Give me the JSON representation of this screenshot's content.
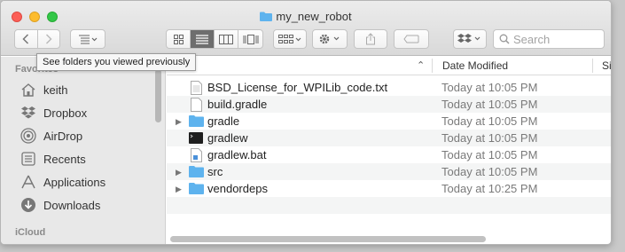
{
  "window": {
    "title": "my_new_robot"
  },
  "toolbar": {
    "search_placeholder": "Search"
  },
  "tooltip": "See folders you viewed previously",
  "sidebar": {
    "favorites_header": "Favorites",
    "items": [
      {
        "label": "keith",
        "icon": "home-icon"
      },
      {
        "label": "Dropbox",
        "icon": "dropbox-icon"
      },
      {
        "label": "AirDrop",
        "icon": "airdrop-icon"
      },
      {
        "label": "Recents",
        "icon": "recents-icon"
      },
      {
        "label": "Applications",
        "icon": "applications-icon"
      },
      {
        "label": "Downloads",
        "icon": "downloads-icon"
      }
    ],
    "icloud_header": "iCloud"
  },
  "columns": {
    "date_modified": "Date Modified",
    "size": "Si"
  },
  "files": [
    {
      "name": "BSD_License_for_WPILib_code.txt",
      "date": "Today at 10:05 PM",
      "kind": "text-file"
    },
    {
      "name": "build.gradle",
      "date": "Today at 10:05 PM",
      "kind": "file"
    },
    {
      "name": "gradle",
      "date": "Today at 10:05 PM",
      "kind": "folder"
    },
    {
      "name": "gradlew",
      "date": "Today at 10:05 PM",
      "kind": "terminal"
    },
    {
      "name": "gradlew.bat",
      "date": "Today at 10:05 PM",
      "kind": "bat-file"
    },
    {
      "name": "src",
      "date": "Today at 10:05 PM",
      "kind": "folder"
    },
    {
      "name": "vendordeps",
      "date": "Today at 10:25 PM",
      "kind": "folder"
    }
  ],
  "colors": {
    "folder": "#5eb3ee",
    "active_view": "#6e6e6e"
  }
}
